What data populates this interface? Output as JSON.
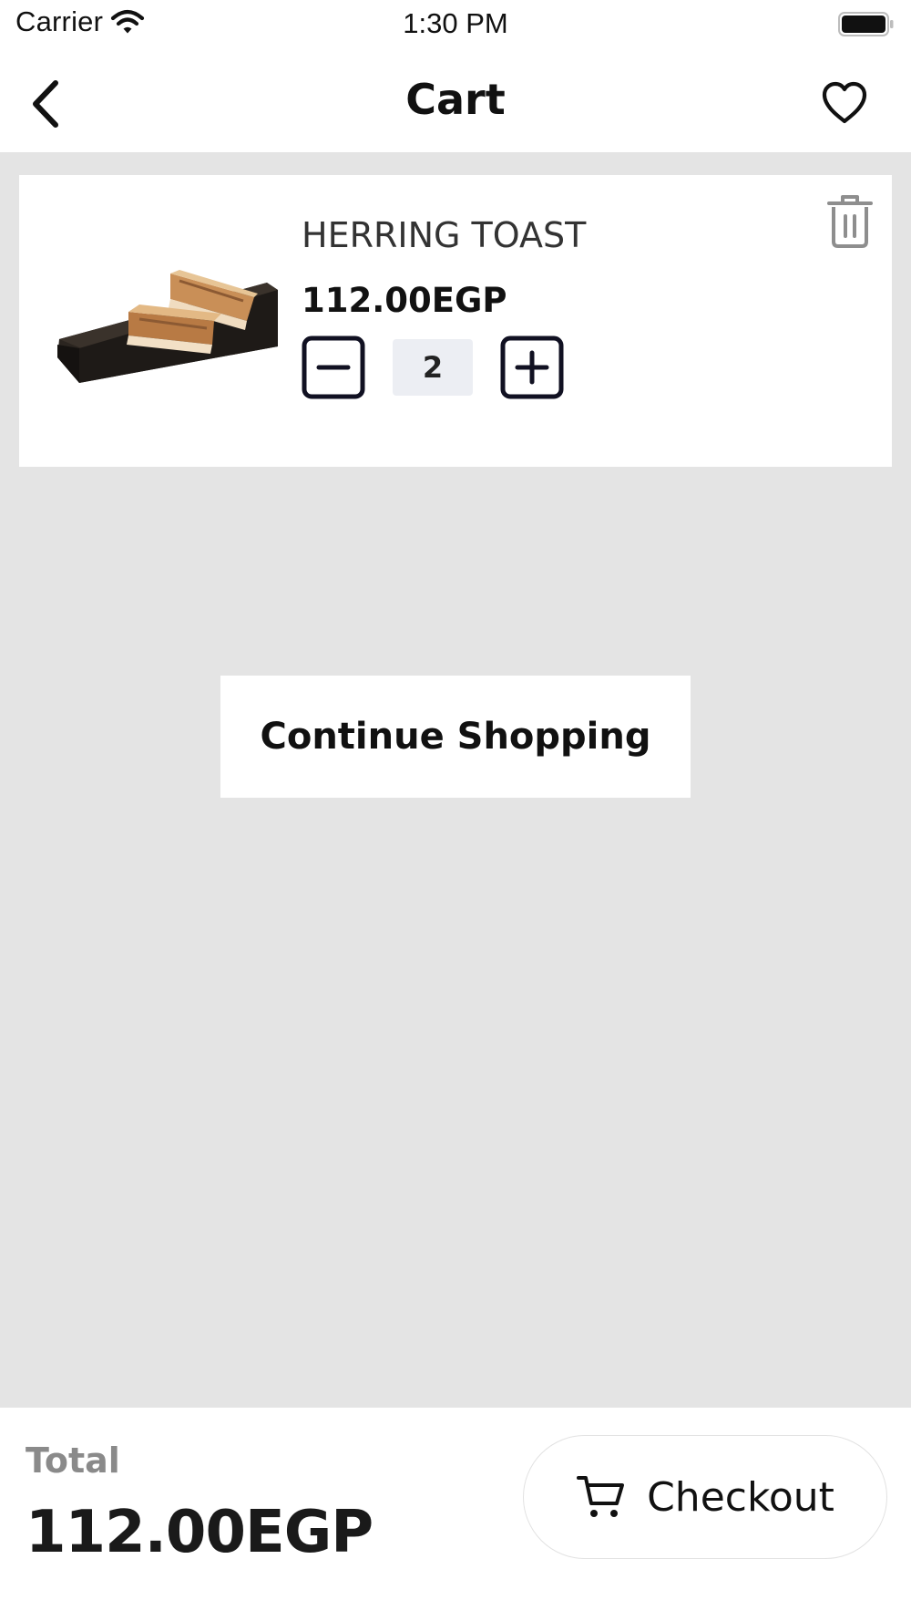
{
  "status_bar": {
    "carrier": "Carrier",
    "time": "1:30 PM",
    "wifi_icon": "wifi-icon",
    "battery_icon": "battery-icon"
  },
  "nav": {
    "title": "Cart",
    "back_icon": "chevron-left-icon",
    "favorite_icon": "heart-icon"
  },
  "cart": {
    "items": [
      {
        "name": "HERRING TOAST",
        "price": "112.00EGP",
        "quantity": "2",
        "image": "herring-toast-on-board",
        "delete_icon": "trash-icon",
        "decrement_icon": "minus-icon",
        "increment_icon": "plus-icon"
      }
    ],
    "continue_shopping_label": "Continue Shopping"
  },
  "footer": {
    "total_label": "Total",
    "total_amount": "112.00EGP",
    "checkout_label": "Checkout",
    "checkout_icon": "cart-icon"
  },
  "colors": {
    "background": "#e4e4e4",
    "surface": "#ffffff",
    "text_primary": "#111111",
    "text_muted": "#8a8a8a",
    "quantity_bg": "#eceef3",
    "icon_muted": "#8e8e8e"
  }
}
